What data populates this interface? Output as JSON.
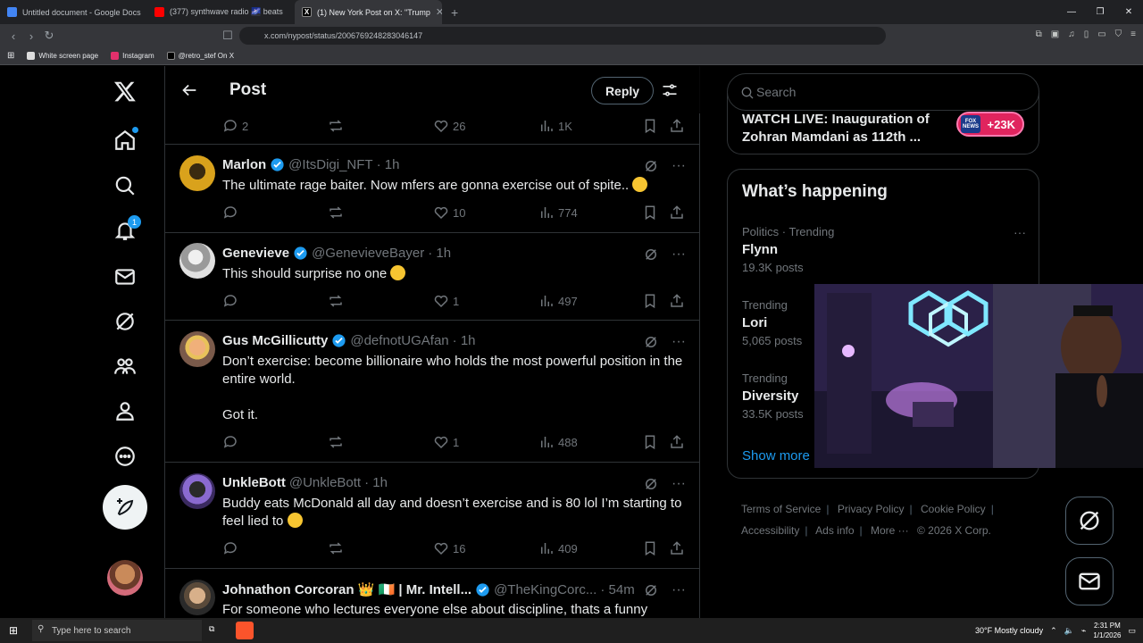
{
  "browser": {
    "tabs": [
      {
        "label": "Untitled document - Google Docs",
        "color": "#4285f4"
      },
      {
        "label": "(377) synthwave radio 🌌 beats",
        "color": "#ff0000"
      },
      {
        "label": "(1) New York Post on X: \"Trump",
        "color": "#000000"
      }
    ],
    "url": "x.com/nypost/status/2006769248283046147",
    "bookmarks": [
      "White screen page",
      "Instagram",
      "@retro_stef On X"
    ]
  },
  "header": {
    "title": "Post",
    "reply_label": "Reply"
  },
  "nav": {
    "notifications_badge": "1"
  },
  "top_actions": {
    "replies": "2",
    "likes": "26",
    "views": "1K"
  },
  "tweets": [
    {
      "name": "Marlon",
      "handle": "@ItsDigi_NFT",
      "time": "· 1h",
      "text": "The ultimate rage baiter. Now mfers are gonna exercise out of spite..",
      "replies": "",
      "likes": "10",
      "views": "774"
    },
    {
      "name": "Genevieve",
      "handle": "@GenevieveBayer",
      "time": "· 1h",
      "text": "This should surprise no one",
      "replies": "",
      "likes": "1",
      "views": "497"
    },
    {
      "name": "Gus McGillicutty",
      "handle": "@defnotUGAfan",
      "time": "· 1h",
      "text": "Don’t exercise: become billionaire who holds the most powerful position in the entire world.\n\nGot it.",
      "replies": "",
      "likes": "1",
      "views": "488"
    },
    {
      "name": "UnkleBott",
      "handle": "@UnkleBott",
      "time": "· 1h",
      "text": "Buddy eats McDonald all day and doesn’t exercise and is 80 lol I’m starting to feel lied to",
      "replies": "",
      "likes": "16",
      "views": "409"
    },
    {
      "name": "Johnathon Corcoran 👑 🇮🇪 | Mr. Intell...",
      "handle": "@TheKingCorc...",
      "time": "· 54m",
      "text": "For someone who lectures everyone else about discipline, thats a funny"
    }
  ],
  "search": {
    "placeholder": "Search"
  },
  "live": {
    "text": "WATCH LIVE: Inauguration of Zohran Mamdani as 112th ...",
    "count": "+23K",
    "badge_label": "FOX NEWS"
  },
  "happening": {
    "title": "What’s happening",
    "trends": [
      {
        "meta": "Politics · Trending",
        "name": "Flynn",
        "count": "19.3K posts"
      },
      {
        "meta": "Trending",
        "name": "Lori",
        "count": "5,065 posts"
      },
      {
        "meta": "Trending",
        "name": "Diversity",
        "count": "33.5K posts"
      }
    ],
    "show_more": "Show more"
  },
  "footer": {
    "links": [
      "Terms of Service",
      "Privacy Policy",
      "Cookie Policy",
      "Accessibility",
      "Ads info",
      "More ···"
    ],
    "copyright": "© 2026 X Corp."
  },
  "taskbar": {
    "search_placeholder": "Type here to search",
    "weather": "30°F  Mostly cloudy",
    "time": "2:31 PM",
    "date": "1/1/2026"
  }
}
